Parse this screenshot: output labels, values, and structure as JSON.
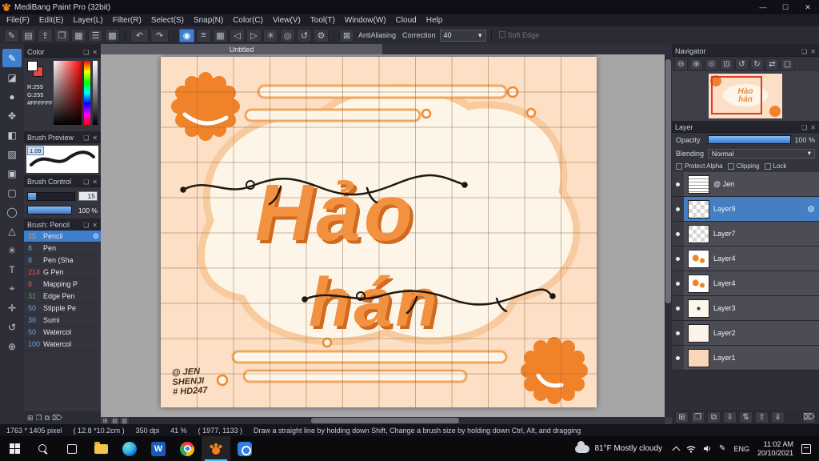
{
  "window": {
    "title": "MediBang Paint Pro (32bit)",
    "minimize": "—",
    "maximize": "☐",
    "close": "✕"
  },
  "menu": {
    "items": [
      "File(F)",
      "Edit(E)",
      "Layer(L)",
      "Filter(R)",
      "Select(S)",
      "Snap(N)",
      "Color(C)",
      "View(V)",
      "Tool(T)",
      "Window(W)",
      "Cloud",
      "Help"
    ]
  },
  "toolbar": {
    "file_icons": [
      {
        "name": "brush-settings",
        "glyph": "✎"
      },
      {
        "name": "save",
        "glyph": "▤"
      },
      {
        "name": "export",
        "glyph": "⇪"
      },
      {
        "name": "comment",
        "glyph": "❐"
      },
      {
        "name": "palette",
        "glyph": "▦"
      },
      {
        "name": "sliders",
        "glyph": "☰"
      },
      {
        "name": "grid",
        "glyph": "▩"
      }
    ],
    "undo": "↶",
    "redo": "↷",
    "snap_icons": [
      {
        "name": "snap-off",
        "glyph": "◉",
        "active": true
      },
      {
        "name": "snap-parallel",
        "glyph": "≡"
      },
      {
        "name": "snap-grid",
        "glyph": "▦"
      },
      {
        "name": "snap-vanish-left",
        "glyph": "◁"
      },
      {
        "name": "snap-vanish-right",
        "glyph": "▷"
      },
      {
        "name": "snap-radial",
        "glyph": "✳"
      },
      {
        "name": "snap-circle",
        "glyph": "◎"
      },
      {
        "name": "snap-curve",
        "glyph": "↺"
      },
      {
        "name": "snap-settings",
        "glyph": "⚙"
      }
    ],
    "antialiasing_icon": "⊠",
    "antialiasing_label": "AntiAliasing",
    "correction_label": "Correction",
    "correction_value": "40",
    "soft_edge_label": "Soft Edge"
  },
  "tools": {
    "items": [
      {
        "name": "brush",
        "glyph": "✎",
        "selected": true
      },
      {
        "name": "eraser",
        "glyph": "◪"
      },
      {
        "name": "dot",
        "glyph": "●"
      },
      {
        "name": "move",
        "glyph": "✥"
      },
      {
        "name": "fill",
        "glyph": "◧"
      },
      {
        "name": "gradient",
        "glyph": "▨"
      },
      {
        "name": "stamp",
        "glyph": "▣"
      },
      {
        "name": "select-rect",
        "glyph": "▢"
      },
      {
        "name": "select-lasso",
        "glyph": "◯"
      },
      {
        "name": "select-poly",
        "glyph": "△"
      },
      {
        "name": "magic-wand",
        "glyph": "✳"
      },
      {
        "name": "text",
        "glyph": "T"
      },
      {
        "name": "eyedropper",
        "glyph": "⌖"
      },
      {
        "name": "hand",
        "glyph": "✛"
      },
      {
        "name": "rotate",
        "glyph": "↺"
      },
      {
        "name": "zoom",
        "glyph": "⊕"
      }
    ]
  },
  "color_panel": {
    "title": "Color",
    "lines": [
      "R:255",
      "G:255",
      "#FFFFFF"
    ]
  },
  "brush_preview": {
    "title": "Brush Preview",
    "value": "1.09"
  },
  "brush_control": {
    "title": "Brush Control",
    "size": "15",
    "opacity": "100 %"
  },
  "brushes": {
    "title": "Brush: Pencil",
    "items": [
      {
        "size": "15",
        "name": "Pencil",
        "color": "#ff8a4d",
        "selected": true
      },
      {
        "size": "8",
        "name": "Pen",
        "color": "#6aa0e0"
      },
      {
        "size": "8",
        "name": "Pen (Sha",
        "color": "#6aa0e0"
      },
      {
        "size": "214",
        "name": "G Pen",
        "color": "#e05548"
      },
      {
        "size": "8",
        "name": "Mapping P",
        "color": "#e05548"
      },
      {
        "size": "31",
        "name": "Edge Pen",
        "color": "#4fae50"
      },
      {
        "size": "50",
        "name": "Stipple Pe",
        "color": "#6aa0e0"
      },
      {
        "size": "30",
        "name": "Sumi",
        "color": "#6aa0e0"
      },
      {
        "size": "50",
        "name": "Watercol",
        "color": "#6aa0e0"
      },
      {
        "size": "100",
        "name": "Watercol",
        "color": "#6aa0e0"
      }
    ]
  },
  "canvas": {
    "tab": "Untitled",
    "art": {
      "title_line1": "Hảo",
      "title_line2": "hán",
      "signature": [
        "@ JEN",
        "SHENJI",
        "# HD247"
      ]
    }
  },
  "navigator": {
    "title": "Navigator",
    "icons": [
      {
        "name": "zoom-out",
        "glyph": "⊖"
      },
      {
        "name": "zoom-in",
        "glyph": "⊕"
      },
      {
        "name": "zoom-100",
        "glyph": "⊙"
      },
      {
        "name": "fit-window",
        "glyph": "⊡"
      },
      {
        "name": "rotate-left",
        "glyph": "↺"
      },
      {
        "name": "rotate-right",
        "glyph": "↻"
      },
      {
        "name": "flip",
        "glyph": "⇄"
      },
      {
        "name": "reset-view",
        "glyph": "▢"
      }
    ]
  },
  "layer_panel": {
    "title": "Layer",
    "opacity_label": "Opacity",
    "opacity_value": "100 %",
    "blending_label": "Blending",
    "blending_value": "Normal",
    "protect_alpha": "Protect Alpha",
    "clipping": "Clipping",
    "lock": "Lock",
    "layers": [
      {
        "name": "@ Jen",
        "selected": false
      },
      {
        "name": "Layer9",
        "selected": true
      },
      {
        "name": "Layer7",
        "selected": false
      },
      {
        "name": "Layer4",
        "selected": false
      },
      {
        "name": "Layer4",
        "selected": false
      },
      {
        "name": "Layer3",
        "selected": false
      },
      {
        "name": "Layer2",
        "selected": false
      },
      {
        "name": "Layer1",
        "selected": false
      }
    ],
    "bottom_icons": [
      {
        "name": "add-layer",
        "glyph": "⊞"
      },
      {
        "name": "new-folder",
        "glyph": "❐"
      },
      {
        "name": "duplicate-layer",
        "glyph": "⧉"
      },
      {
        "name": "merge-down",
        "glyph": "⇩"
      },
      {
        "name": "transfer",
        "glyph": "⇅"
      },
      {
        "name": "move-up",
        "glyph": "⇧"
      },
      {
        "name": "move-down",
        "glyph": "⇓"
      },
      {
        "name": "delete-layer",
        "glyph": "⌦"
      }
    ]
  },
  "status": {
    "size": "1763 * 1405 pixel",
    "dimensions": "( 12.8 *10.2cm )",
    "dpi": "350 dpi",
    "zoom": "41 %",
    "coords": "( 1977, 1133 )",
    "hint": "Draw a straight line by holding down Shift, Change a brush size by holding down Ctrl, Alt, and dragging"
  },
  "taskbar": {
    "weather": "81°F Mostly cloudy",
    "language": "ENG",
    "time": "11:02 AM",
    "date": "20/10/2021"
  }
}
